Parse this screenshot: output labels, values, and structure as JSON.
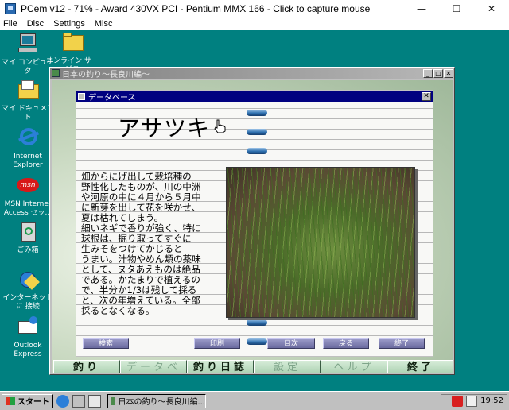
{
  "host": {
    "title": "PCem v12 - 71% - Award 430VX PCI - Pentium MMX 166 - Click to capture mouse",
    "menu": [
      "File",
      "Disc",
      "Settings",
      "Misc"
    ],
    "controls": {
      "minimize": "—",
      "maximize": "☐",
      "close": "✕"
    }
  },
  "desktop": {
    "icons": [
      {
        "label": "マイ コンピュータ",
        "icon": "my-computer-icon"
      },
      {
        "label": "オンライン サービス",
        "icon": "online-services-folder-icon"
      },
      {
        "label": "マイ ドキュメント",
        "icon": "my-documents-icon"
      },
      {
        "label": "Internet Explorer",
        "icon": "internet-explorer-icon"
      },
      {
        "label": "MSN Internet Access セッ...",
        "icon": "msn-icon"
      },
      {
        "label": "ごみ箱",
        "icon": "recycle-bin-icon"
      },
      {
        "label": "インターネットに 接続",
        "icon": "connect-internet-icon"
      },
      {
        "label": "Outlook Express",
        "icon": "outlook-express-icon"
      }
    ]
  },
  "app": {
    "title": "日本の釣り〜長良川編〜",
    "db": {
      "title": "データベース",
      "close": "✕",
      "species": "アサツキ",
      "desc_lines": [
        "畑からにげ出して栽培種の",
        "野性化したものが、川の中洲",
        "や河原の中に４月から５月中",
        "に新芽を出して花を咲かせ、",
        "夏は枯れてしまう。",
        "細いネギで香りが強く、特に",
        "球根は、掘り取ってすぐに",
        "生みそをつけてかじると",
        "うまい。汁物やめん類の薬味",
        "として、ヌタあえものは絶品",
        "である。かたまりで植えるの",
        "で、半分か1/3は残して採る",
        "と、次の年増えている。全部",
        "採るとなくなる。"
      ],
      "buttons": {
        "search": "検索",
        "print": "印刷",
        "index": "目次",
        "back": "戻る",
        "end": "終了"
      }
    },
    "nav": {
      "fish": "釣り",
      "database": "データベース",
      "diary": "釣り日誌",
      "settings": "設定",
      "help": "ヘルプ",
      "quit": "終了"
    }
  },
  "taskbar": {
    "start": "スタート",
    "task": "日本の釣り〜長良川編...",
    "clock": "19:52"
  }
}
